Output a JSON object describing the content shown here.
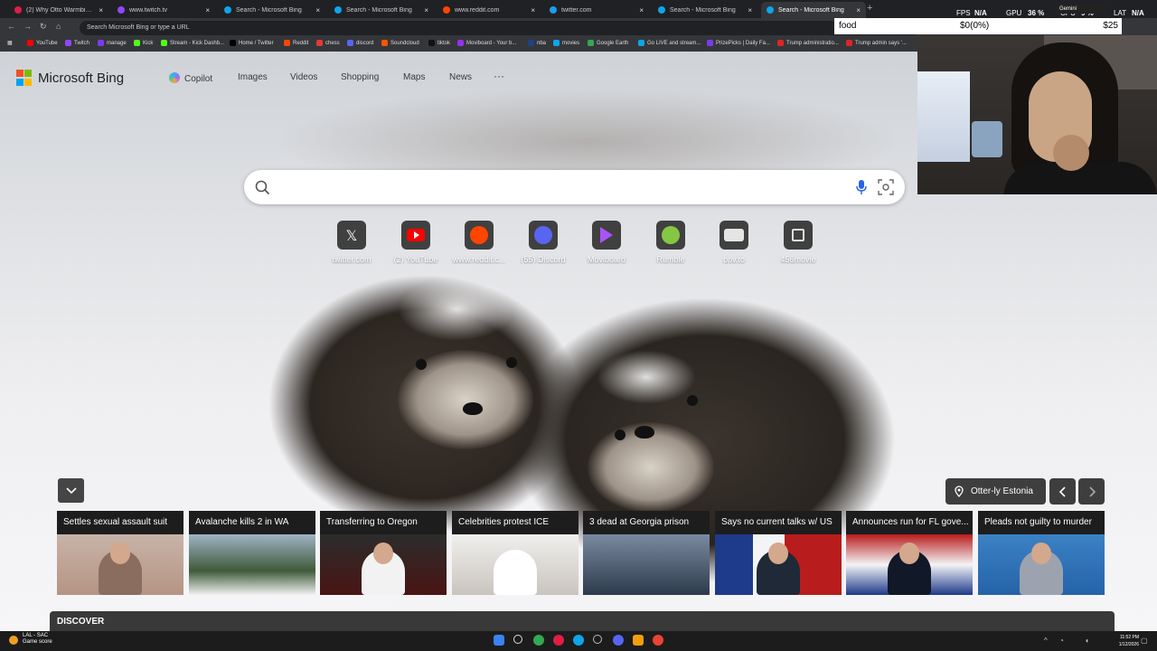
{
  "browser": {
    "tabs": [
      {
        "title": "(2) Why Otto Warmbier Die",
        "color": "#e11d48"
      },
      {
        "title": "www.twitch.tv",
        "color": "#9146ff"
      },
      {
        "title": "Search - Microsoft Bing",
        "color": "#0ea5e9"
      },
      {
        "title": "Search - Microsoft Bing",
        "color": "#0ea5e9"
      },
      {
        "title": "www.reddit.com",
        "color": "#ff4500"
      },
      {
        "title": "twitter.com",
        "color": "#1d9bf0"
      },
      {
        "title": "Search - Microsoft Bing",
        "color": "#0ea5e9"
      },
      {
        "title": "Search - Microsoft Bing",
        "color": "#0ea5e9",
        "active": true
      }
    ],
    "address_placeholder": "Search Microsoft Bing or type a URL",
    "bookmarks": [
      {
        "label": "YouTube",
        "color": "#ff0000"
      },
      {
        "label": "Twitch",
        "color": "#9146ff"
      },
      {
        "label": "manage",
        "color": "#7c3aed"
      },
      {
        "label": "Kick",
        "color": "#53fc18"
      },
      {
        "label": "Stream - Kick Dashb...",
        "color": "#53fc18"
      },
      {
        "label": "Home / Twitter",
        "color": "#000000"
      },
      {
        "label": "Reddit",
        "color": "#ff4500"
      },
      {
        "label": "chess",
        "color": "#e53935"
      },
      {
        "label": "discord",
        "color": "#5865f2"
      },
      {
        "label": "Soundcloud",
        "color": "#ff5500"
      },
      {
        "label": "tiktok",
        "color": "#111111"
      },
      {
        "label": "Moviboard - Your b...",
        "color": "#9333ea"
      },
      {
        "label": "nba",
        "color": "#1d428a"
      },
      {
        "label": "movies",
        "color": "#0ea5e9"
      },
      {
        "label": "Google Earth",
        "color": "#34a853"
      },
      {
        "label": "Go LIVE and stream...",
        "color": "#0ea5e9"
      },
      {
        "label": "PrizePicks | Daily Fa...",
        "color": "#7c3aed"
      },
      {
        "label": "Trump administratio...",
        "color": "#dc2626"
      },
      {
        "label": "Trump admin says '...",
        "color": "#dc2626"
      }
    ]
  },
  "overlay": {
    "food_label": "food",
    "food_mid": "$0(0%)",
    "food_right": "$25",
    "fps_label": "FPS",
    "fps_value": "N/A",
    "gpu_label": "GPU",
    "gpu_value": "36 %",
    "cpu_label": "CPU",
    "cpu_value": "9 %",
    "lat_label": "LAT",
    "lat_value": "N/A",
    "gemini_label": "Gemini"
  },
  "bing": {
    "logo_text": "Microsoft Bing",
    "nav": [
      "Copilot",
      "Images",
      "Videos",
      "Shopping",
      "Maps",
      "News"
    ],
    "more": "···",
    "search_value": "",
    "tiles": [
      {
        "label": "twitter.com",
        "icon": "x-icon"
      },
      {
        "label": "(2) YouTube",
        "icon": "youtube-icon"
      },
      {
        "label": "www.reddit.c...",
        "icon": "reddit-icon"
      },
      {
        "label": "(55) Discord",
        "icon": "discord-icon"
      },
      {
        "label": "Moviboard",
        "icon": "moviboard-icon"
      },
      {
        "label": "Rumble",
        "icon": "rumble-icon"
      },
      {
        "label": "ppv.to",
        "icon": "ppv-icon"
      },
      {
        "label": "456movie",
        "icon": "movie-icon"
      }
    ],
    "location_label": "Otter-ly Estonia",
    "news": [
      {
        "headline": "Settles sexual assault suit",
        "bg": "#b69483"
      },
      {
        "headline": "Avalanche kills 2 in WA",
        "bg": "#6b8aa3"
      },
      {
        "headline": "Transferring to Oregon",
        "bg": "#9a3b3b"
      },
      {
        "headline": "Celebrities protest ICE",
        "bg": "#e5e5e5"
      },
      {
        "headline": "3 dead at Georgia prison",
        "bg": "#4a5a6e"
      },
      {
        "headline": "Says no current talks w/ US",
        "bg": "#1e3a8a"
      },
      {
        "headline": "Announces run for FL gove...",
        "bg": "#7b1d1d"
      },
      {
        "headline": "Pleads not guilty to murder",
        "bg": "#3b82c4"
      }
    ],
    "discover_label": "DISCOVER"
  },
  "taskbar": {
    "game_line1": "LAL - SAC",
    "game_line2": "Game score",
    "time": "11:52 PM",
    "date": "1/12/2026"
  }
}
